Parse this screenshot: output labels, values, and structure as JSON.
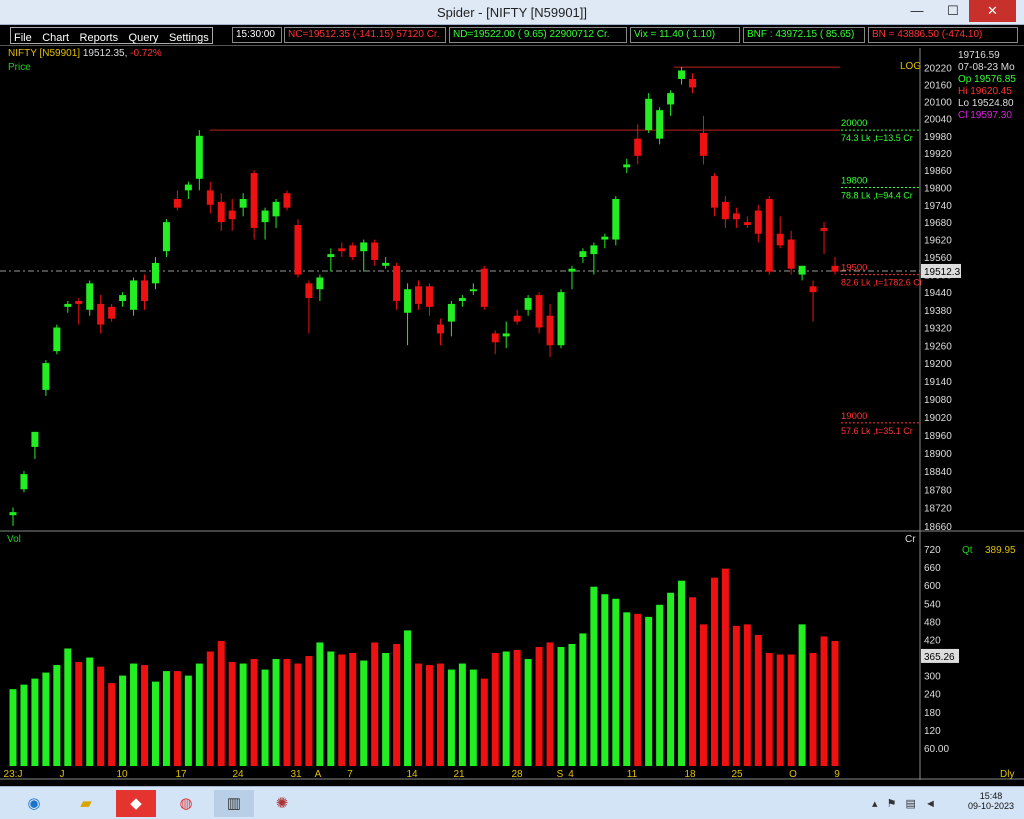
{
  "window": {
    "title": "Spider - [NIFTY [N59901]]",
    "minimize": "—",
    "maximize": "☐",
    "close": "✕"
  },
  "menu": [
    "File",
    "Chart",
    "Reports",
    "Query",
    "Settings"
  ],
  "time": "15:30:00",
  "tickers": [
    {
      "text": "NC=19512.35  (-141.15)  57120  Cr.",
      "color": "#ff3333"
    },
    {
      "text": "ND=19522.00  (   9.65)  22900712  Cr.",
      "color": "#33ff33"
    },
    {
      "text": "Vix =    11.40  (    1.10)",
      "color": "#33ff33"
    },
    {
      "text": "BNF : 43972.15  (  85.65)",
      "color": "#33ff33"
    },
    {
      "text": "BN = 43886.50  (-474.10)",
      "color": "#ff3333"
    }
  ],
  "symbol": {
    "name": "NIFTY [N59901]",
    "price": "19512.35,",
    "change": "-0.72%"
  },
  "labels": {
    "price": "Price",
    "log": "LOG",
    "vol": "Vol",
    "cr": "Cr",
    "dly": "Dly"
  },
  "ohlc": {
    "top": "19716.59",
    "date": "07-08-23 Mo",
    "open": "Op 19576.85",
    "high": "Hi  19620.45",
    "low": "Lo  19524.80",
    "close": "Cl  19597.30"
  },
  "qt": {
    "label": "Qt",
    "value": "389.95"
  },
  "current_price_tag": "19512.3",
  "current_vol_tag": "365.26",
  "levels": [
    {
      "price": "20000",
      "detail": "74.3 Lk ,t=13.5 Cr",
      "color": "#33ff33"
    },
    {
      "price": "19800",
      "detail": "78.8 Lk ,t=94.4 Cr",
      "color": "#33ff33"
    },
    {
      "price": "19500",
      "detail": "82.6 Lk ,t=1782.6 Cr",
      "color": "#ff3333"
    },
    {
      "price": "19000",
      "detail": "57.6 Lk ,t=35.1 Cr",
      "color": "#ff3333"
    }
  ],
  "price_axis": [
    "20220",
    "20160",
    "20100",
    "20040",
    "19980",
    "19920",
    "19860",
    "19800",
    "19740",
    "19680",
    "19620",
    "19560",
    "19500",
    "19440",
    "19380",
    "19320",
    "19260",
    "19200",
    "19140",
    "19080",
    "19020",
    "18960",
    "18900",
    "18840",
    "18780",
    "18720",
    "18660"
  ],
  "vol_axis": [
    "720",
    "660",
    "600",
    "540",
    "480",
    "420",
    "360",
    "300",
    "240",
    "180",
    "120",
    "60.00"
  ],
  "x_axis": [
    "23:J",
    "J",
    "10",
    "17",
    "24",
    "31",
    "A",
    "7",
    "14",
    "21",
    "28",
    "S",
    "4",
    "11",
    "18",
    "25",
    "O",
    "9"
  ],
  "chart_data": {
    "type": "candlestick",
    "price_scale": "log",
    "price_range": [
      18640,
      20240
    ],
    "volume_range": [
      0,
      750
    ],
    "candles": [
      {
        "o": 18695,
        "h": 18720,
        "l": 18660,
        "c": 18705
      },
      {
        "o": 18780,
        "h": 18840,
        "l": 18770,
        "c": 18830
      },
      {
        "o": 18920,
        "h": 18960,
        "l": 18880,
        "c": 18970
      },
      {
        "o": 19110,
        "h": 19210,
        "l": 19090,
        "c": 19200
      },
      {
        "o": 19240,
        "h": 19330,
        "l": 19230,
        "c": 19320
      },
      {
        "o": 19390,
        "h": 19410,
        "l": 19370,
        "c": 19400
      },
      {
        "o": 19410,
        "h": 19420,
        "l": 19330,
        "c": 19400
      },
      {
        "o": 19380,
        "h": 19480,
        "l": 19360,
        "c": 19470
      },
      {
        "o": 19400,
        "h": 19430,
        "l": 19300,
        "c": 19330
      },
      {
        "o": 19390,
        "h": 19400,
        "l": 19340,
        "c": 19350
      },
      {
        "o": 19410,
        "h": 19440,
        "l": 19390,
        "c": 19430
      },
      {
        "o": 19380,
        "h": 19490,
        "l": 19360,
        "c": 19480
      },
      {
        "o": 19480,
        "h": 19500,
        "l": 19380,
        "c": 19410
      },
      {
        "o": 19470,
        "h": 19560,
        "l": 19450,
        "c": 19540
      },
      {
        "o": 19580,
        "h": 19690,
        "l": 19560,
        "c": 19680
      },
      {
        "o": 19760,
        "h": 19790,
        "l": 19720,
        "c": 19730
      },
      {
        "o": 19790,
        "h": 19820,
        "l": 19760,
        "c": 19810
      },
      {
        "o": 19830,
        "h": 20000,
        "l": 19790,
        "c": 19980
      },
      {
        "o": 19790,
        "h": 19820,
        "l": 19710,
        "c": 19740
      },
      {
        "o": 19750,
        "h": 19780,
        "l": 19650,
        "c": 19680
      },
      {
        "o": 19720,
        "h": 19760,
        "l": 19650,
        "c": 19690
      },
      {
        "o": 19730,
        "h": 19780,
        "l": 19700,
        "c": 19760
      },
      {
        "o": 19850,
        "h": 19860,
        "l": 19620,
        "c": 19660
      },
      {
        "o": 19680,
        "h": 19730,
        "l": 19620,
        "c": 19720
      },
      {
        "o": 19700,
        "h": 19760,
        "l": 19660,
        "c": 19750
      },
      {
        "o": 19780,
        "h": 19790,
        "l": 19720,
        "c": 19730
      },
      {
        "o": 19670,
        "h": 19690,
        "l": 19490,
        "c": 19500
      },
      {
        "o": 19470,
        "h": 19480,
        "l": 19300,
        "c": 19420
      },
      {
        "o": 19450,
        "h": 19500,
        "l": 19410,
        "c": 19490
      },
      {
        "o": 19560,
        "h": 19590,
        "l": 19510,
        "c": 19570
      },
      {
        "o": 19590,
        "h": 19610,
        "l": 19560,
        "c": 19580
      },
      {
        "o": 19600,
        "h": 19610,
        "l": 19550,
        "c": 19560
      },
      {
        "o": 19580,
        "h": 19620,
        "l": 19510,
        "c": 19610
      },
      {
        "o": 19610,
        "h": 19620,
        "l": 19530,
        "c": 19550
      },
      {
        "o": 19530,
        "h": 19560,
        "l": 19520,
        "c": 19540
      },
      {
        "o": 19530,
        "h": 19540,
        "l": 19380,
        "c": 19410
      },
      {
        "o": 19370,
        "h": 19470,
        "l": 19260,
        "c": 19450
      },
      {
        "o": 19460,
        "h": 19480,
        "l": 19380,
        "c": 19400
      },
      {
        "o": 19460,
        "h": 19470,
        "l": 19360,
        "c": 19390
      },
      {
        "o": 19330,
        "h": 19350,
        "l": 19260,
        "c": 19300
      },
      {
        "o": 19340,
        "h": 19410,
        "l": 19290,
        "c": 19400
      },
      {
        "o": 19410,
        "h": 19430,
        "l": 19390,
        "c": 19420
      },
      {
        "o": 19450,
        "h": 19470,
        "l": 19430,
        "c": 19450
      },
      {
        "o": 19520,
        "h": 19530,
        "l": 19380,
        "c": 19390
      },
      {
        "o": 19300,
        "h": 19310,
        "l": 19230,
        "c": 19270
      },
      {
        "o": 19290,
        "h": 19340,
        "l": 19250,
        "c": 19300
      },
      {
        "o": 19360,
        "h": 19380,
        "l": 19330,
        "c": 19340
      },
      {
        "o": 19380,
        "h": 19430,
        "l": 19360,
        "c": 19420
      },
      {
        "o": 19430,
        "h": 19440,
        "l": 19300,
        "c": 19320
      },
      {
        "o": 19360,
        "h": 19400,
        "l": 19220,
        "c": 19260
      },
      {
        "o": 19260,
        "h": 19450,
        "l": 19250,
        "c": 19440
      },
      {
        "o": 19510,
        "h": 19530,
        "l": 19450,
        "c": 19520
      },
      {
        "o": 19560,
        "h": 19590,
        "l": 19540,
        "c": 19580
      },
      {
        "o": 19570,
        "h": 19610,
        "l": 19500,
        "c": 19600
      },
      {
        "o": 19620,
        "h": 19640,
        "l": 19590,
        "c": 19630
      },
      {
        "o": 19620,
        "h": 19770,
        "l": 19600,
        "c": 19760
      },
      {
        "o": 19870,
        "h": 19900,
        "l": 19850,
        "c": 19880
      },
      {
        "o": 19970,
        "h": 20020,
        "l": 19880,
        "c": 19910
      },
      {
        "o": 20000,
        "h": 20130,
        "l": 19990,
        "c": 20110
      },
      {
        "o": 19970,
        "h": 20080,
        "l": 19950,
        "c": 20070
      },
      {
        "o": 20090,
        "h": 20140,
        "l": 20050,
        "c": 20130
      },
      {
        "o": 20180,
        "h": 20222,
        "l": 20160,
        "c": 20210
      },
      {
        "o": 20180,
        "h": 20200,
        "l": 20130,
        "c": 20150
      },
      {
        "o": 19990,
        "h": 20050,
        "l": 19880,
        "c": 19910
      },
      {
        "o": 19840,
        "h": 19850,
        "l": 19700,
        "c": 19730
      },
      {
        "o": 19750,
        "h": 19770,
        "l": 19660,
        "c": 19690
      },
      {
        "o": 19710,
        "h": 19730,
        "l": 19660,
        "c": 19690
      },
      {
        "o": 19680,
        "h": 19700,
        "l": 19660,
        "c": 19670
      },
      {
        "o": 19720,
        "h": 19740,
        "l": 19610,
        "c": 19640
      },
      {
        "o": 19760,
        "h": 19770,
        "l": 19500,
        "c": 19510
      },
      {
        "o": 19640,
        "h": 19700,
        "l": 19590,
        "c": 19600
      },
      {
        "o": 19620,
        "h": 19650,
        "l": 19500,
        "c": 19520
      },
      {
        "o": 19500,
        "h": 19530,
        "l": 19480,
        "c": 19530
      },
      {
        "o": 19460,
        "h": 19480,
        "l": 19340,
        "c": 19440
      },
      {
        "o": 19660,
        "h": 19680,
        "l": 19570,
        "c": 19650
      },
      {
        "o": 19530,
        "h": 19560,
        "l": 19500,
        "c": 19510
      }
    ],
    "volumes": [
      255,
      270,
      290,
      310,
      335,
      390,
      345,
      360,
      330,
      275,
      300,
      340,
      335,
      280,
      315,
      315,
      300,
      340,
      380,
      415,
      345,
      340,
      355,
      320,
      355,
      355,
      340,
      365,
      410,
      380,
      370,
      375,
      350,
      410,
      375,
      405,
      450,
      340,
      335,
      340,
      320,
      340,
      320,
      290,
      375,
      380,
      385,
      355,
      395,
      410,
      395,
      405,
      440,
      595,
      570,
      555,
      510,
      505,
      495,
      535,
      575,
      615,
      560,
      470,
      625,
      655,
      465,
      470,
      435,
      375,
      370,
      370,
      470,
      375,
      430,
      415
    ]
  }
}
